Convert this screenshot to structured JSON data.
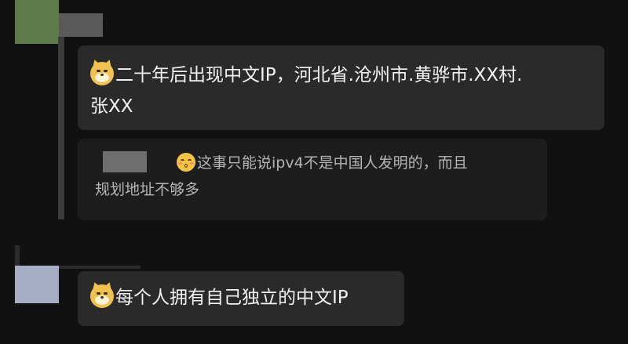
{
  "thread": {
    "comment": {
      "emoji": "doge-icon",
      "text_line1": "二十年后出现中文IP，河北省.沧州市.黄骅市.XX村.",
      "text_line2": "张XX"
    },
    "reply": {
      "emoji": "kiss-icon",
      "text_line1": "这事只能说ipv4不是中国人发明的，而且",
      "text_line2": "规划地址不够多"
    }
  },
  "comment2": {
    "emoji": "doge-icon",
    "text": "每个人拥有自己独立的中文IP"
  },
  "colors": {
    "background": "#111111",
    "bubble": "#2a2a2a",
    "reply_card": "#1d1d1d",
    "text": "#f2f2f2",
    "reply_text": "#b5b5b5"
  }
}
